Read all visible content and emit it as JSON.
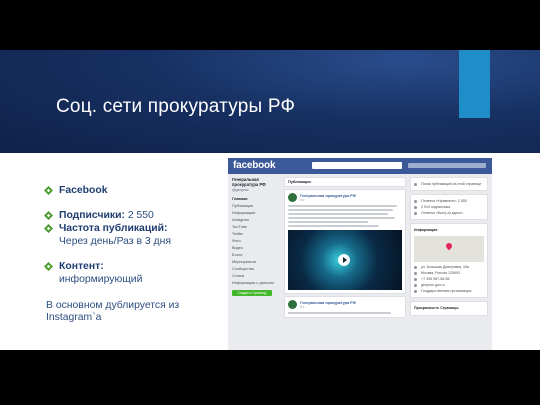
{
  "slide": {
    "title": "Соц. сети прокуратуры РФ",
    "colors": {
      "band": "#173062",
      "accent": "#1f8ec8",
      "bullet_text": "#2d4d80",
      "bullet_icon": "#4a9a2e"
    }
  },
  "bullets": [
    {
      "icon": "diamond-bullet-icon",
      "label": "Facebook",
      "value": ""
    },
    {
      "icon": "diamond-bullet-icon",
      "label": "Подписчики:",
      "value": "2 550"
    },
    {
      "icon": "diamond-bullet-icon",
      "label": "Частота публикаций:",
      "value": "Через день/Раз в 3 дня"
    },
    {
      "icon": "diamond-bullet-icon",
      "label": "Контент:",
      "value": "информирующий"
    }
  ],
  "note": "В основном дублируется из Instagram`a",
  "facebook": {
    "logo": "facebook",
    "page_name": "Генеральная прокуратура РФ",
    "handle": "@genproc",
    "menu": [
      "Главная",
      "Публикации",
      "Информация",
      "Instagram",
      "YouTube",
      "Twitter",
      "Фото",
      "Видео",
      "Блоги",
      "Мероприятия",
      "Сообщество",
      "Статьи",
      "Информация о датском"
    ],
    "create_button": "Создать Страницу",
    "feed_header": "Публикации",
    "post_name": "Генеральная прокуратура РФ",
    "post_time": "4 ч · ",
    "post2_time": "5 ч · ",
    "right_placeholder": "Поиск публикаций на этой странице",
    "right_stats": [
      "Отметки «Нравится»: 2 550",
      "2 514 подписчика",
      "Отметки «Был(-а) здесь»"
    ],
    "right_info_header": "Информация",
    "right_info_rows": [
      "ул. Большая Дмитровка, 15а",
      "Москва, Россия 125993",
      "+7 495 987-56-56",
      "genproc.gov.ru",
      "Государственная организация"
    ],
    "transparency_header": "Прозрачность Страницы"
  }
}
